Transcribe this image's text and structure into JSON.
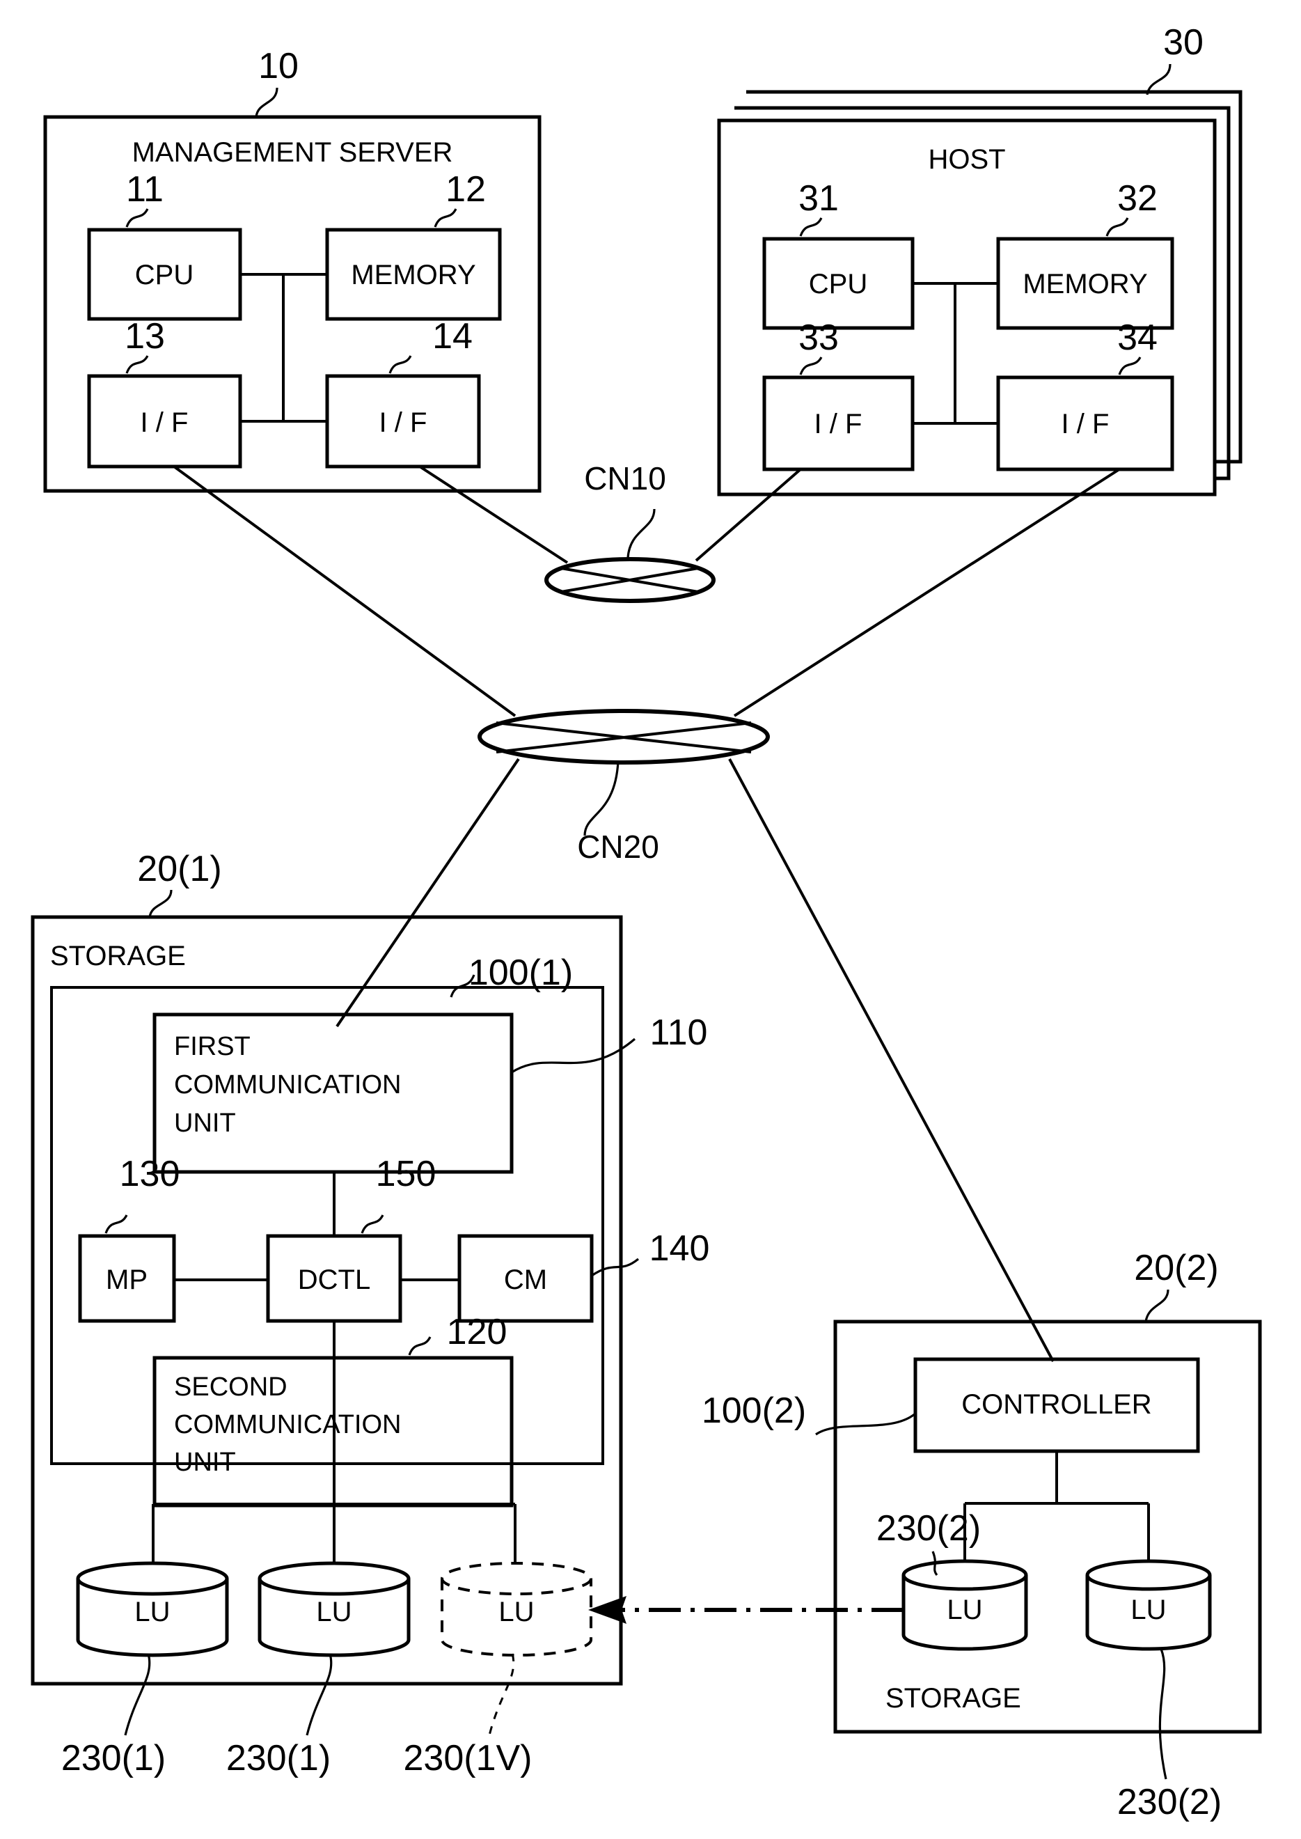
{
  "figure": {
    "type": "patent-block-diagram",
    "description": "Storage system block diagram with management server, hosts, networks and two storage apparatuses"
  },
  "management_server": {
    "title": "MANAGEMENT SERVER",
    "ref": "10",
    "components": [
      {
        "label": "CPU",
        "ref": "11"
      },
      {
        "label": "MEMORY",
        "ref": "12"
      },
      {
        "label": "I / F",
        "ref": "13"
      },
      {
        "label": "I / F",
        "ref": "14"
      }
    ]
  },
  "host": {
    "title": "HOST",
    "ref": "30",
    "stacked": true,
    "components": [
      {
        "label": "CPU",
        "ref": "31"
      },
      {
        "label": "MEMORY",
        "ref": "32"
      },
      {
        "label": "I / F",
        "ref": "33"
      },
      {
        "label": "I / F",
        "ref": "34"
      }
    ]
  },
  "networks": [
    {
      "label": "CN10"
    },
    {
      "label": "CN20"
    }
  ],
  "storage_one": {
    "title": "STORAGE",
    "ref": "20(1)",
    "controller_ref": "100(1)",
    "blocks": [
      {
        "label": "FIRST COMMUNICATION UNIT",
        "ref": "110",
        "lines": [
          "FIRST",
          "COMMUNICATION",
          "UNIT"
        ]
      },
      {
        "label": "MP",
        "ref": "130"
      },
      {
        "label": "DCTL",
        "ref": "150"
      },
      {
        "label": "CM",
        "ref": "140"
      },
      {
        "label": "SECOND COMMUNICATION UNIT",
        "ref": "120",
        "lines": [
          "SECOND",
          "COMMUNICATION",
          "UNIT"
        ]
      }
    ],
    "volumes": [
      {
        "label": "LU",
        "ref": "230(1)",
        "virtual": false
      },
      {
        "label": "LU",
        "ref": "230(1)",
        "virtual": false
      },
      {
        "label": "LU",
        "ref": "230(1V)",
        "virtual": true
      }
    ]
  },
  "storage_two": {
    "title": "STORAGE",
    "ref": "20(2)",
    "controller_ref": "100(2)",
    "controller_label": "CONTROLLER",
    "volume_ref_top": "230(2)",
    "volume_ref_bottom": "230(2)",
    "volumes": [
      {
        "label": "LU"
      },
      {
        "label": "LU"
      }
    ]
  }
}
